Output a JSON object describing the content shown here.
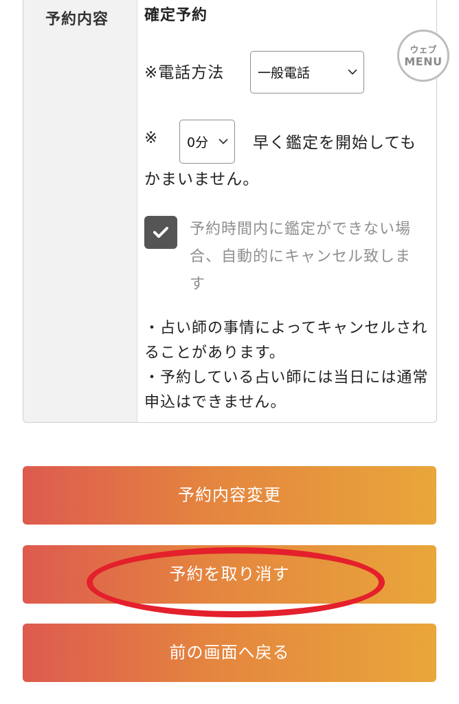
{
  "reservation": {
    "label": "予約内容",
    "type": "確定予約",
    "phone_method": {
      "label": "※電話方法",
      "selected": "一般電話"
    },
    "early_start": {
      "mark": "※",
      "selected": "0分",
      "text_line1": "早く鑑定を開始しても",
      "text_line2": "かまいません。"
    },
    "auto_cancel": {
      "checked": true,
      "text": "予約時間内に鑑定ができない場合、自動的にキャンセル致します"
    },
    "notes": [
      "・占い師の事情によってキャンセルされることがあります。",
      "・予約している占い師には当日には通常申込はできません。"
    ]
  },
  "web_menu": {
    "line1": "ウェブ",
    "line2": "MENU"
  },
  "buttons": {
    "change": "予約内容変更",
    "cancel": "予約を取り消す",
    "back": "前の画面へ戻る"
  },
  "colors": {
    "button_gradient_start": "#dd5a4f",
    "button_gradient_end": "#e9a63a",
    "annotation_circle": "#e3202b",
    "checkbox": "#555555"
  }
}
